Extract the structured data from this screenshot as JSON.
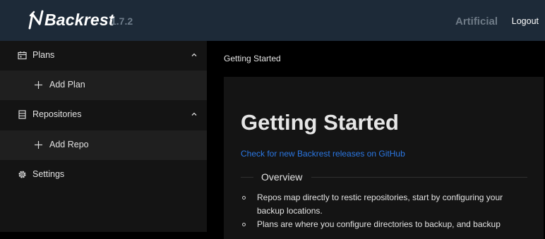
{
  "header": {
    "app_name": "Backrest",
    "version": "1.7.2",
    "username": "Artificial",
    "logout_label": "Logout"
  },
  "sidebar": {
    "items": [
      {
        "label": "Plans",
        "icon": "calendar-icon",
        "expanded": true
      },
      {
        "label": "Add Plan",
        "icon": "plus-icon"
      },
      {
        "label": "Repositories",
        "icon": "database-icon",
        "expanded": true
      },
      {
        "label": "Add Repo",
        "icon": "plus-icon"
      },
      {
        "label": "Settings",
        "icon": "gear-icon"
      }
    ]
  },
  "main": {
    "breadcrumb": "Getting Started",
    "title": "Getting Started",
    "release_link": "Check for new Backrest releases on GitHub",
    "section_title": "Overview",
    "bullets": [
      "Repos map directly to restic repositories, start by configuring your backup locations.",
      "Plans are where you configure directories to backup, and backup"
    ]
  },
  "colors": {
    "header_bg": "#1d2a38",
    "sidebar_bg": "#141414",
    "sub_item_bg": "#1f1f1f",
    "link": "#2b78e4"
  }
}
